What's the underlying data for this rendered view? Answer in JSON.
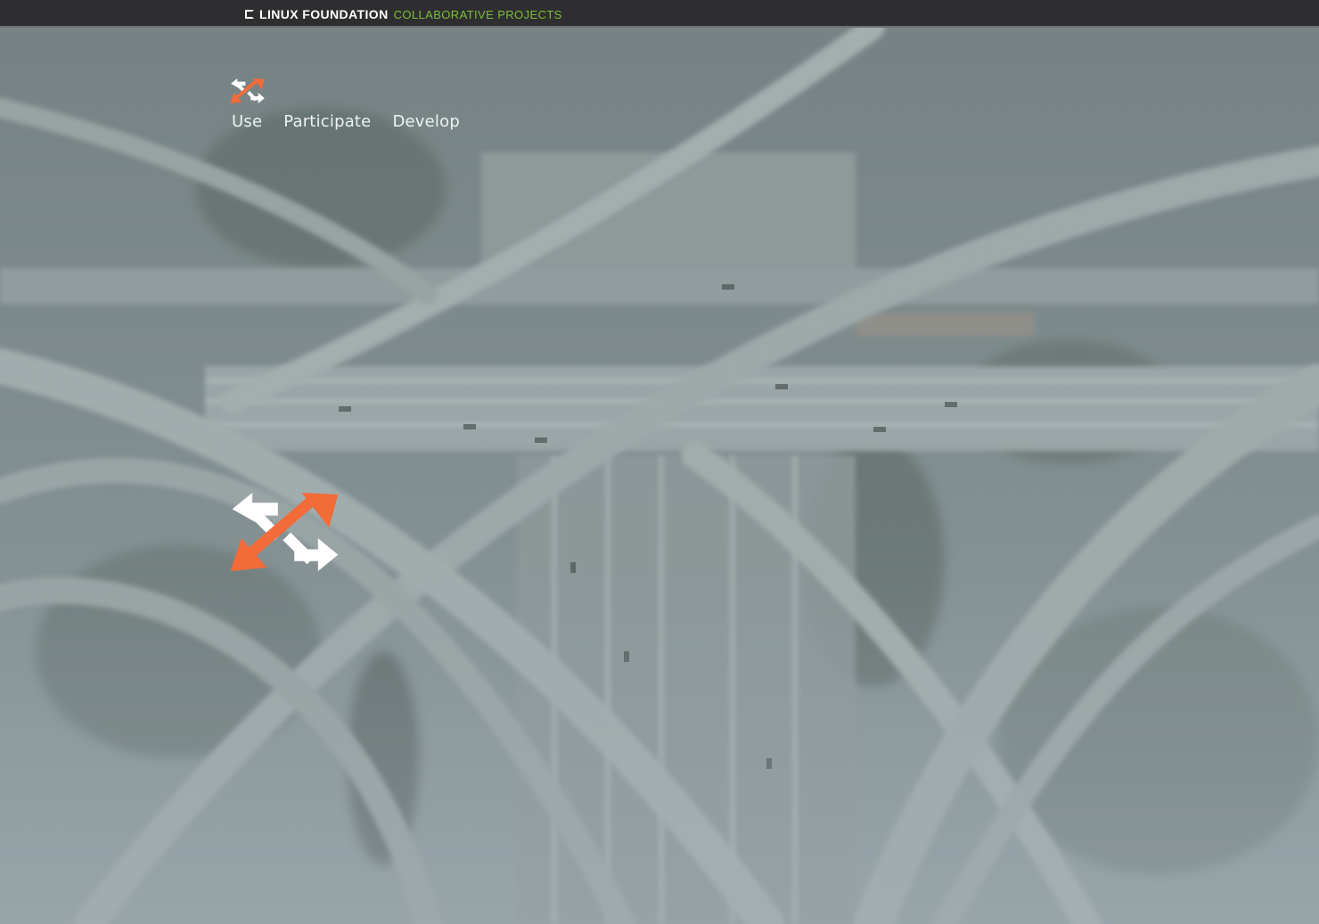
{
  "topbar": {
    "brand": "LINUX FOUNDATION",
    "subtitle": "COLLABORATIVE PROJECTS"
  },
  "nav": {
    "items": [
      {
        "label": "Use"
      },
      {
        "label": "Participate"
      },
      {
        "label": "Develop"
      }
    ]
  },
  "colors": {
    "accent_orange": "#f26b38",
    "logo_white": "#ffffff",
    "topbar_bg": "#2e2e30",
    "lf_green": "#7cbf3a",
    "hero_overlay": "#8d9ba0"
  },
  "icons": {
    "header_logo": "swap-arrows-logo-icon",
    "hero_logo": "swap-arrows-logo-icon",
    "lf_mark": "linux-foundation-mark-icon"
  }
}
